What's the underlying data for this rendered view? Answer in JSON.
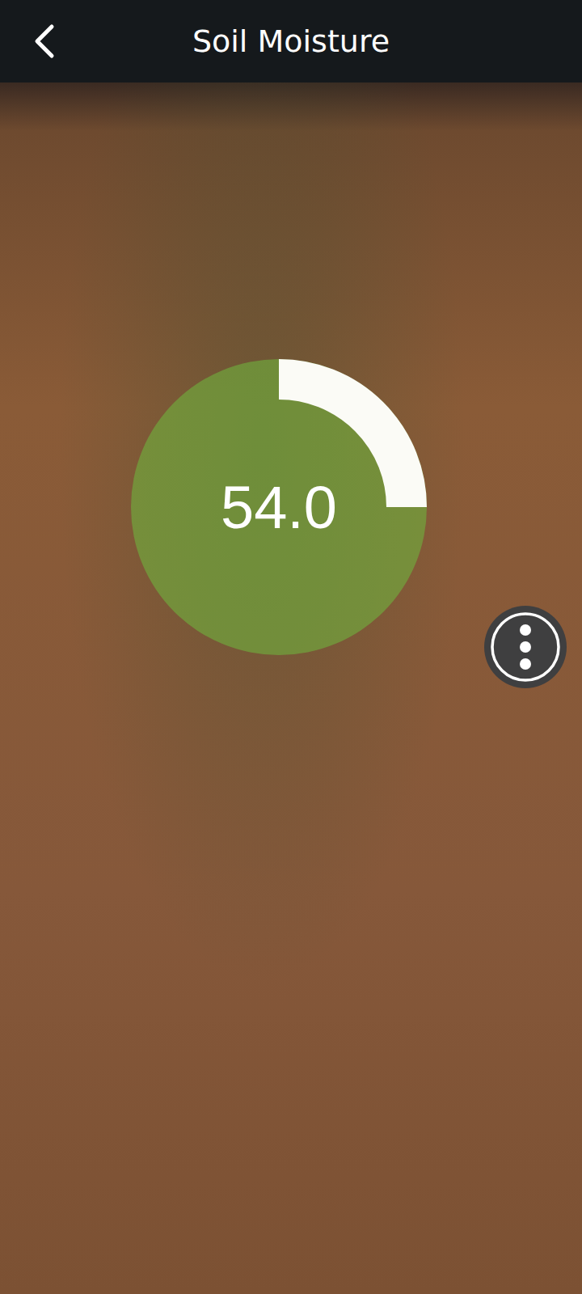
{
  "header": {
    "title": "Soil Moisture"
  },
  "gauge": {
    "value": "54.0",
    "level": 0.25
  }
}
